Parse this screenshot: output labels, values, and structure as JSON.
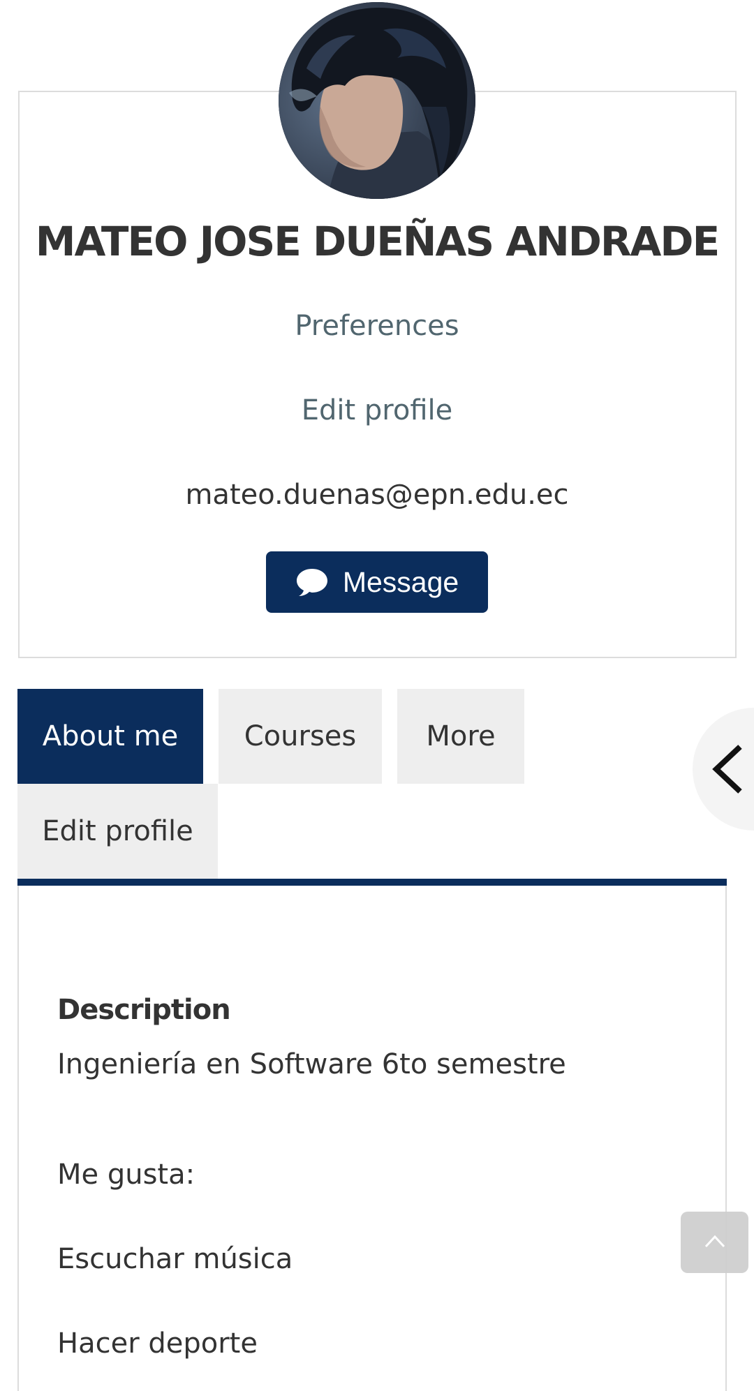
{
  "profile": {
    "full_name": "MATEO JOSE DUEÑAS ANDRADE",
    "links": {
      "preferences": "Preferences",
      "edit_profile": "Edit profile"
    },
    "email": "mateo.duenas@epn.edu.ec",
    "message_button": "Message",
    "avatar_icon": "user-photo"
  },
  "tabs": [
    {
      "label": "About me",
      "active": true
    },
    {
      "label": "Courses",
      "active": false
    },
    {
      "label": "More",
      "active": false
    },
    {
      "label": "Edit profile",
      "active": false
    }
  ],
  "about": {
    "heading": "Description",
    "lines": [
      "Ingeniería en Software 6to semestre",
      "Me gusta:",
      "Escuchar música",
      "Hacer deporte"
    ]
  },
  "icons": {
    "message": "speech-bubble-icon",
    "drawer_toggle": "chevron-left-icon",
    "back_to_top": "chevron-up-icon"
  },
  "colors": {
    "primary": "#0b2d5c",
    "link": "#51666f",
    "tab_inactive": "#eeeeee",
    "text": "#333333"
  }
}
